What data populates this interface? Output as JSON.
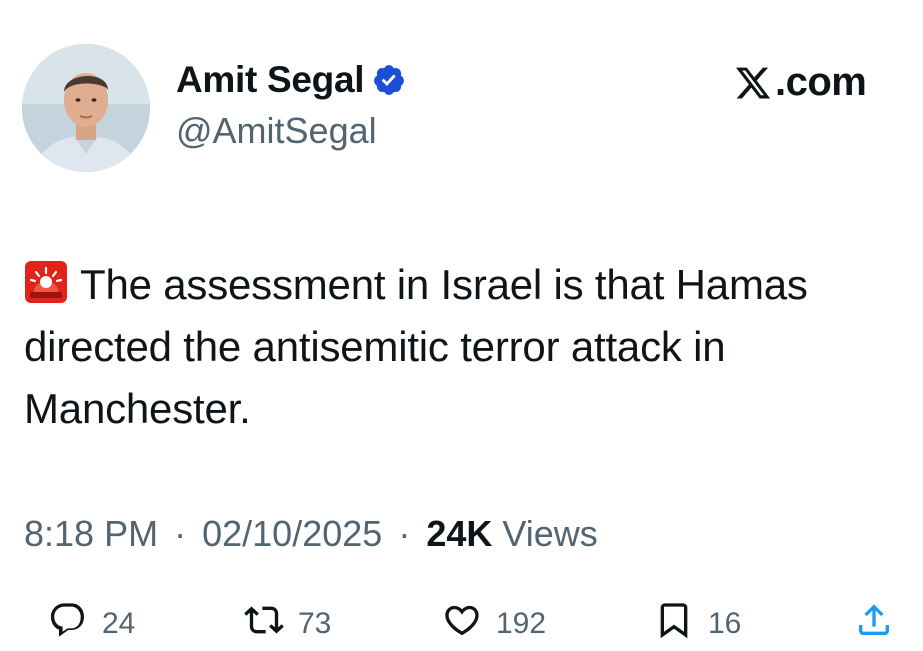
{
  "author": {
    "display_name": "Amit Segal",
    "handle": "@AmitSegal",
    "verified": true
  },
  "brand": {
    "label": ".com",
    "logo_icon": "x-logo-icon"
  },
  "tweet": {
    "emoji_icon": "police-siren-icon",
    "text": "The assessment in Israel is that Hamas directed the antisemitic terror attack in Manchester."
  },
  "meta": {
    "time": "8:18 PM",
    "date": "02/10/2025",
    "views_count": "24K",
    "views_label": "Views",
    "separator": "·"
  },
  "actions": {
    "replies": "24",
    "reposts": "73",
    "likes": "192",
    "bookmarks": "16"
  },
  "colors": {
    "text": "#0f1419",
    "secondary": "#536471",
    "verified_badge": "#1d4ed8"
  }
}
